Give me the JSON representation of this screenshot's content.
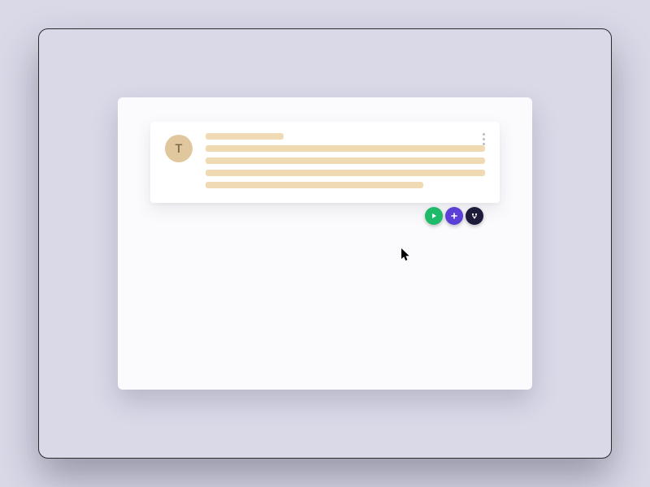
{
  "card": {
    "avatar_initial": "T"
  },
  "placeholders": {
    "title_bar": "",
    "line1": "",
    "line2": "",
    "line3": "",
    "line4": ""
  },
  "actions": {
    "play_label": "play",
    "add_label": "add",
    "branch_label": "branch"
  },
  "colors": {
    "page_bg": "#d9d9e8",
    "window_bg": "#fbfbfd",
    "card_bg": "#ffffff",
    "avatar_bg": "#e0c79e",
    "placeholder_bar": "#efdab3",
    "fab_play": "#1fb96a",
    "fab_add": "#5b3fd6",
    "fab_branch": "#1d1b3a"
  }
}
